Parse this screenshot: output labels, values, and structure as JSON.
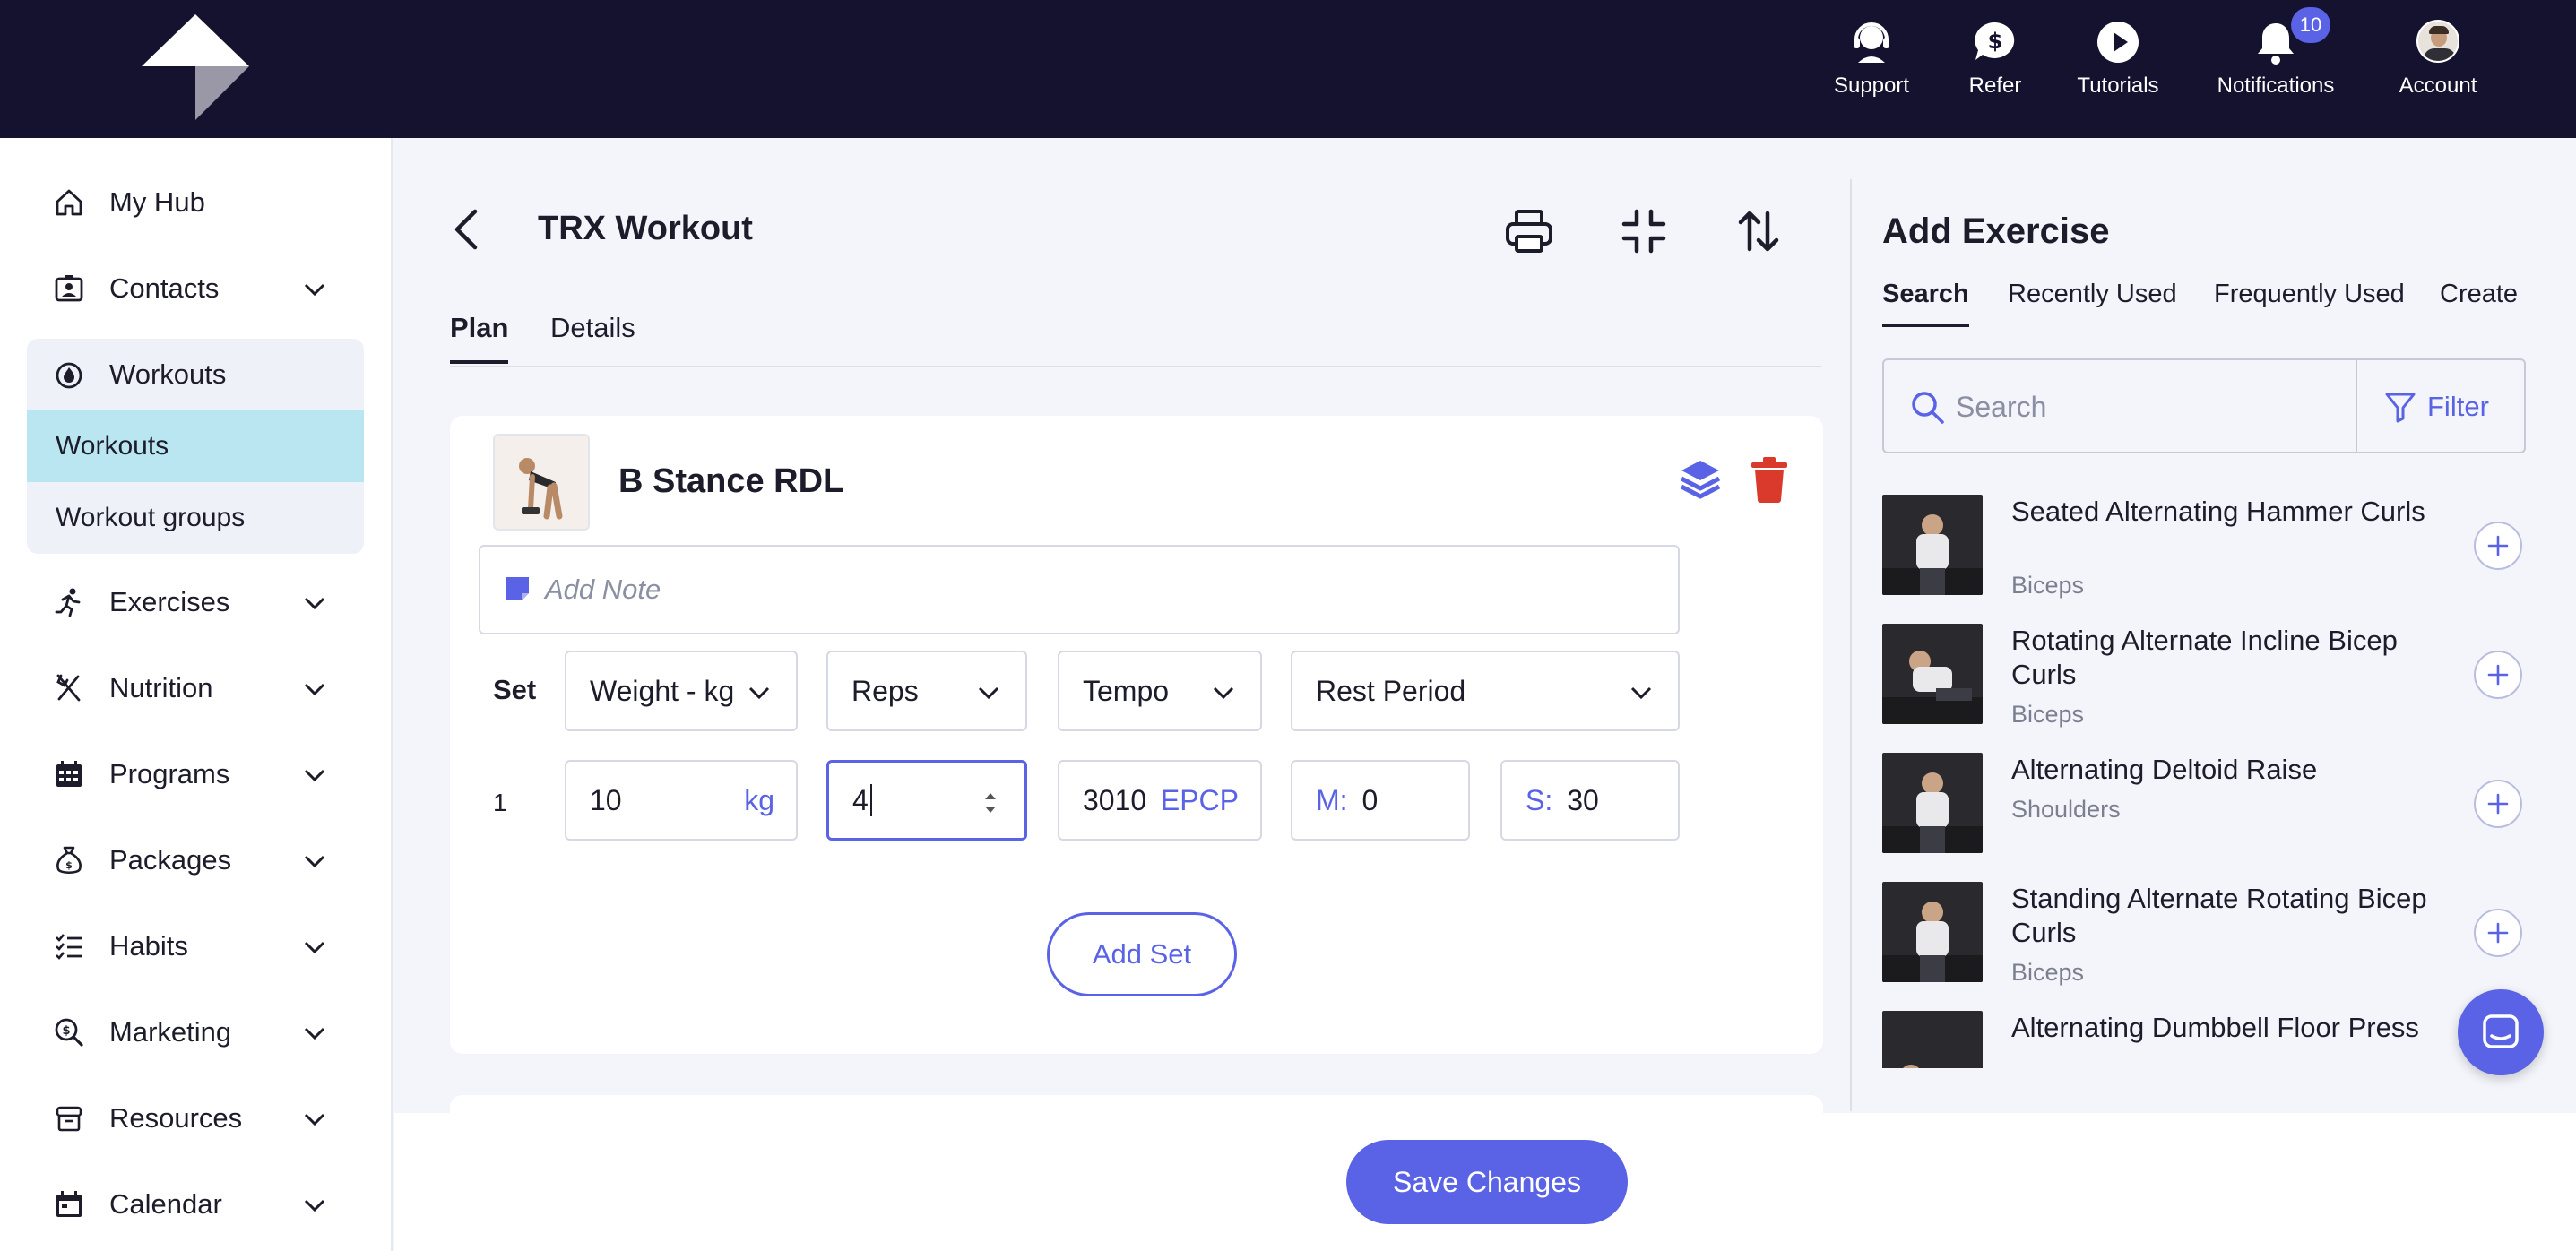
{
  "topbar": {
    "support": "Support",
    "refer": "Refer",
    "tutorials": "Tutorials",
    "notifications": "Notifications",
    "notifications_count": "10",
    "account": "Account"
  },
  "sidebar": {
    "my_hub": "My Hub",
    "contacts": "Contacts",
    "workouts": "Workouts",
    "workouts_sub": "Workouts",
    "workout_groups": "Workout groups",
    "exercises": "Exercises",
    "nutrition": "Nutrition",
    "programs": "Programs",
    "packages": "Packages",
    "habits": "Habits",
    "marketing": "Marketing",
    "resources": "Resources",
    "calendar": "Calendar"
  },
  "main": {
    "title": "TRX Workout",
    "tabs": [
      "Plan",
      "Details"
    ],
    "exercise": {
      "name": "B Stance RDL",
      "note_placeholder": "Add Note",
      "set_label": "Set",
      "columns": [
        "Weight - kg",
        "Reps",
        "Tempo",
        "Rest Period"
      ],
      "row": {
        "number": "1",
        "weight": "10",
        "weight_unit": "kg",
        "reps": "4",
        "tempo": "3010",
        "tempo_unit": "EPCP",
        "rest_m_label": "M:",
        "rest_m": "0",
        "rest_s_label": "S:",
        "rest_s": "30"
      },
      "add_set": "Add Set"
    }
  },
  "right_panel": {
    "title": "Add Exercise",
    "tabs": [
      "Search",
      "Recently Used",
      "Frequently Used",
      "Create"
    ],
    "search_placeholder": "Search",
    "filter_label": "Filter",
    "exercises": [
      {
        "name": "Seated Alternating Hammer Curls",
        "category": "Biceps"
      },
      {
        "name": "Rotating Alternate Incline Bicep Curls",
        "category": "Biceps"
      },
      {
        "name": "Alternating Deltoid Raise",
        "category": "Shoulders"
      },
      {
        "name": "Standing Alternate Rotating Bicep Curls",
        "category": "Biceps"
      },
      {
        "name": "Alternating Dumbbell Floor Press",
        "category": ""
      }
    ]
  },
  "footer": {
    "save": "Save Changes"
  },
  "colors": {
    "topbar": "#15122f",
    "accent": "#5a63e6",
    "active_sub": "#b9e6f0",
    "delete": "#d93a2b"
  }
}
